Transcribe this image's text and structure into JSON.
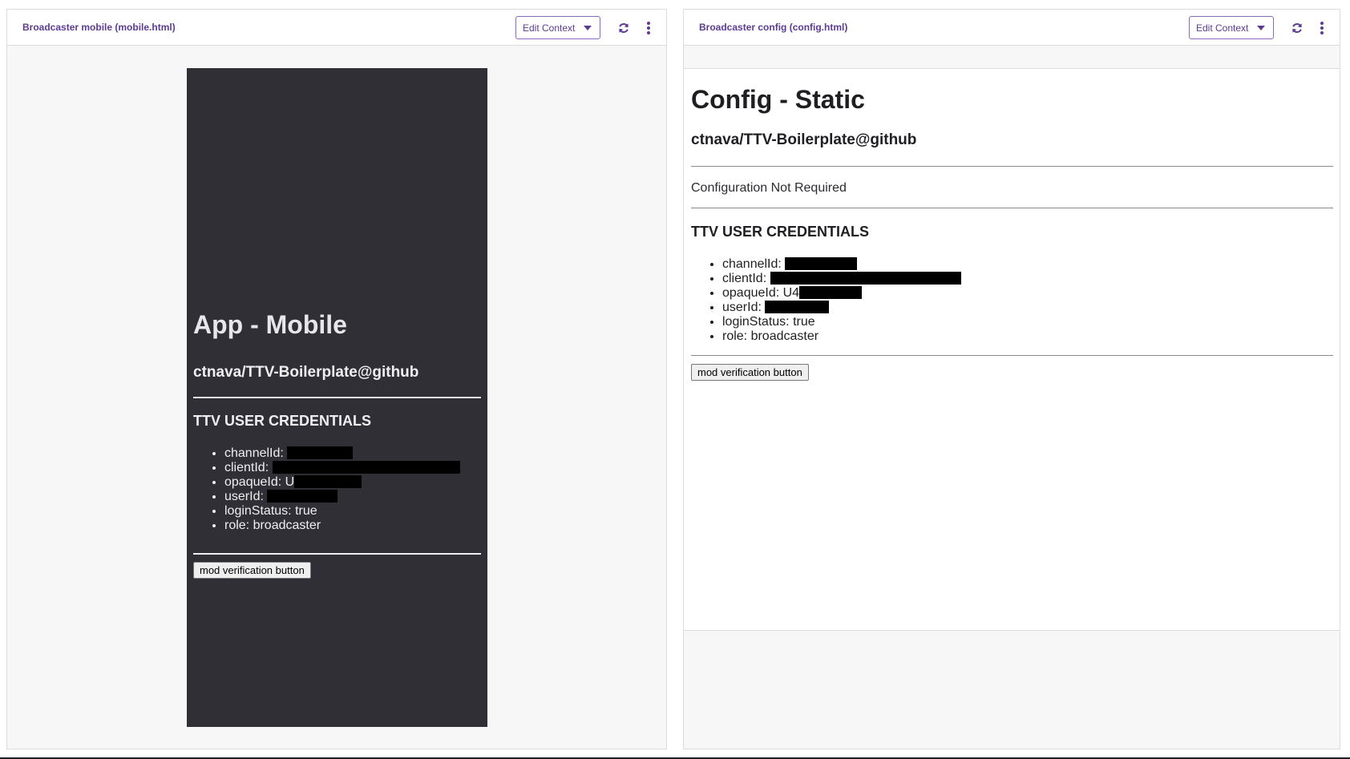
{
  "left_panel": {
    "title": "Broadcaster mobile (mobile.html)",
    "edit_context_label": "Edit Context",
    "frame": {
      "heading": "App - Mobile",
      "repo": "ctnava/TTV-Boilerplate@github",
      "credentials_title": "TTV USER CREDENTIALS",
      "credentials": [
        {
          "label": "channelId: ",
          "value": "",
          "redacted": true
        },
        {
          "label": "clientId: ",
          "value": "",
          "redacted": true
        },
        {
          "label": "opaqueId: U",
          "value": "",
          "redacted": true
        },
        {
          "label": "userId: ",
          "value": "",
          "redacted": true
        },
        {
          "label": "loginStatus: ",
          "value": "true",
          "redacted": false
        },
        {
          "label": "role: ",
          "value": "broadcaster",
          "redacted": false
        }
      ],
      "button_label": "mod verification button"
    }
  },
  "right_panel": {
    "title": "Broadcaster config (config.html)",
    "edit_context_label": "Edit Context",
    "frame": {
      "heading": "Config - Static",
      "repo": "ctnava/TTV-Boilerplate@github",
      "config_status": "Configuration Not Required",
      "credentials_title": "TTV USER CREDENTIALS",
      "credentials": [
        {
          "label": "channelId: ",
          "value": "",
          "redacted": true
        },
        {
          "label": "clientId: ",
          "value": "",
          "redacted": true
        },
        {
          "label": "opaqueId: U4",
          "value": "",
          "redacted": true
        },
        {
          "label": "userId: ",
          "value": "",
          "redacted": true
        },
        {
          "label": "loginStatus: ",
          "value": "true",
          "redacted": false
        },
        {
          "label": "role: ",
          "value": "broadcaster",
          "redacted": false
        }
      ],
      "button_label": "mod verification button"
    }
  },
  "colors": {
    "accent": "#5c3b93",
    "mobile_background": "#302f35",
    "panel_background": "#f7f7f8"
  },
  "icons": [
    "refresh-icon",
    "more-vertical-icon",
    "chevron-down-icon"
  ]
}
